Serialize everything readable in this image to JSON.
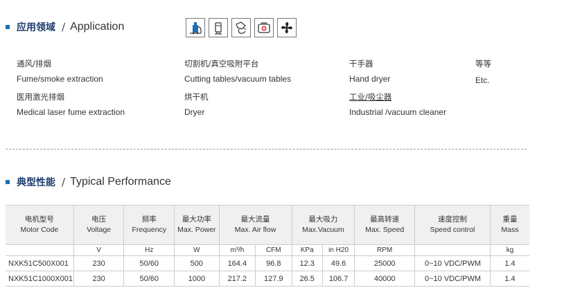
{
  "application": {
    "title_zh": "应用领域",
    "separator": "/",
    "title_en": "Application",
    "icons": [
      "vacuum-cleaner-icon",
      "fume-extractor-icon",
      "hand-dryer-icon",
      "medical-kit-icon",
      "fan-icon"
    ],
    "items": [
      {
        "zh": "通风/排烟",
        "en": "Fume/smoke extraction"
      },
      {
        "zh": "医用激光排烟",
        "en": "Medical laser fume extraction"
      },
      {
        "zh": "切割机/真空吸附平台",
        "en": "Cutting tables/vacuum tables"
      },
      {
        "zh": "烘干机",
        "en": "Dryer"
      },
      {
        "zh": "干手器",
        "en": "Hand dryer"
      },
      {
        "zh": "工业/吸尘器",
        "en": "Industrial /vacuum cleaner"
      },
      {
        "zh": "等等",
        "en": "Etc."
      }
    ]
  },
  "performance": {
    "title_zh": "典型性能",
    "separator": "/",
    "title_en": "Typical Performance",
    "headers": [
      {
        "zh": "电机型号",
        "en": "Motor Code"
      },
      {
        "zh": "电压",
        "en": "Voltage"
      },
      {
        "zh": "频率",
        "en": "Frequency"
      },
      {
        "zh": "最大功率",
        "en": "Max. Power"
      },
      {
        "zh": "最大流量",
        "en": "Max. Air flow"
      },
      {
        "zh": "最大吸力",
        "en": "Max.Vacuum"
      },
      {
        "zh": "最高转速",
        "en": "Max. Speed"
      },
      {
        "zh": "速度控制",
        "en": "Speed control"
      },
      {
        "zh": "重量",
        "en": "Mass"
      }
    ],
    "units": [
      "",
      "V",
      "Hz",
      "W",
      "m³/h",
      "CFM",
      "KPa",
      "in H20",
      "RPM",
      "",
      "kg"
    ],
    "rows": [
      [
        "NXK51C500X001",
        "230",
        "50/60",
        "500",
        "164.4",
        "96.8",
        "12.3",
        "49.6",
        "25000",
        "0~10 VDC/PWM",
        "1.4"
      ],
      [
        "NXK51C1000X001",
        "230",
        "50/60",
        "1000",
        "217.2",
        "127.9",
        "26.5",
        "106.7",
        "40000",
        "0~10 VDC/PWM",
        "1.4"
      ]
    ]
  }
}
